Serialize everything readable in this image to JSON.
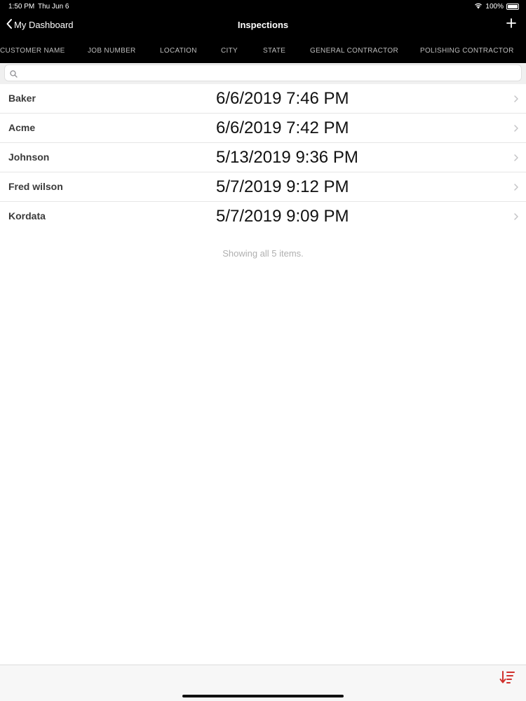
{
  "status": {
    "time": "1:50 PM",
    "date": "Thu Jun 6",
    "battery": "100%",
    "wifi_icon": "wifi-icon",
    "battery_icon": "battery-icon"
  },
  "nav": {
    "back_label": "My Dashboard",
    "title": "Inspections",
    "add_icon": "plus-icon"
  },
  "columns": [
    "CUSTOMER NAME",
    "JOB NUMBER",
    "LOCATION",
    "CITY",
    "STATE",
    "GENERAL CONTRACTOR",
    "POLISHING CONTRACTOR"
  ],
  "search": {
    "placeholder": "",
    "value": ""
  },
  "rows": [
    {
      "name": "Baker",
      "date": "6/6/2019 7:46 PM"
    },
    {
      "name": "Acme",
      "date": "6/6/2019 7:42 PM"
    },
    {
      "name": "Johnson",
      "date": "5/13/2019 9:36 PM"
    },
    {
      "name": "Fred wilson",
      "date": "5/7/2019 9:12 PM"
    },
    {
      "name": "Kordata",
      "date": "5/7/2019 9:09 PM"
    }
  ],
  "footer": {
    "count_text": "Showing all 5 items."
  },
  "colors": {
    "accent": "#d0312d",
    "bar": "#000000",
    "column_text": "#bdbdbd",
    "muted": "#b0b0b0"
  }
}
